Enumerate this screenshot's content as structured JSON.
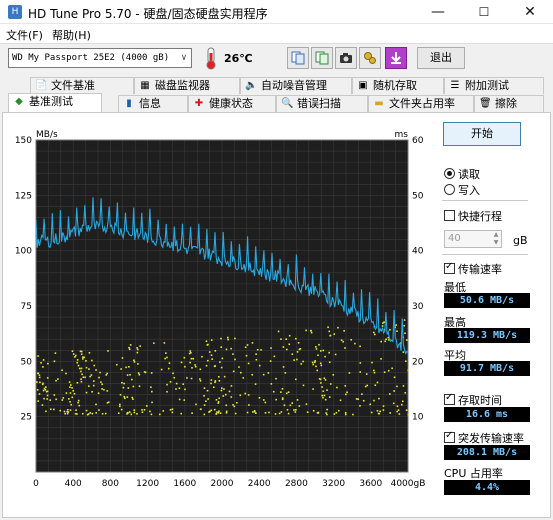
{
  "window": {
    "title": "HD Tune Pro 5.70 - 硬盘/固态硬盘实用程序",
    "app_icon_char": "H",
    "minimize": "—",
    "maximize": "☐",
    "close": "✕"
  },
  "menu": {
    "file": "文件(F)",
    "help": "帮助(H)"
  },
  "toolbar": {
    "drive_value": "WD     My Passport 25E2 (4000 gB)",
    "temperature": "26℃",
    "exit_label": "退出"
  },
  "tabs_top": [
    "文件基准",
    "磁盘监视器",
    "自动噪音管理",
    "随机存取",
    "附加测试"
  ],
  "tabs_bottom": [
    "基准测试",
    "信息",
    "健康状态",
    "错误扫描",
    "文件夹占用率",
    "擦除"
  ],
  "side": {
    "start_label": "开始",
    "read_label": "读取",
    "write_label": "写入",
    "short_stroke_label": "快捷行程",
    "short_stroke_value": "40",
    "short_stroke_unit": "gB",
    "transfer_rate_label": "传输速率",
    "min_label": "最低",
    "min_value": "50.6 MB/s",
    "max_label": "最高",
    "max_value": "119.3 MB/s",
    "avg_label": "平均",
    "avg_value": "91.7 MB/s",
    "access_time_label": "存取时间",
    "access_time_value": "16.6 ms",
    "burst_rate_label": "突发传输速率",
    "burst_rate_value": "208.1 MB/s",
    "cpu_label": "CPU 占用率",
    "cpu_value": "4.4%"
  },
  "colors": {
    "rate_line": "#2aa8e0",
    "access_dots": "#e8e83a",
    "lcd_text": "#7ec8ff",
    "chart_bg": "#1e1e1e"
  },
  "chart_data": {
    "type": "line",
    "left_unit": "MB/s",
    "right_unit": "ms",
    "y_ticks_left": [
      "150",
      "125",
      "100",
      "75",
      "50",
      "25"
    ],
    "y_ticks_right": [
      "60",
      "50",
      "40",
      "30",
      "20",
      "10"
    ],
    "x_ticks": [
      "0",
      "400",
      "800",
      "1200",
      "1600",
      "2000",
      "2400",
      "2800",
      "3200",
      "3600",
      "4000gB"
    ],
    "xlim": [
      0,
      4000
    ],
    "ylim_left": [
      0,
      150
    ],
    "ylim_right": [
      0,
      60
    ],
    "grid": true,
    "series": [
      {
        "kind": "transfer_rate",
        "x": [
          0,
          100,
          200,
          300,
          400,
          500,
          600,
          700,
          800,
          900,
          1000,
          1100,
          1200,
          1300,
          1400,
          1500,
          1600,
          1700,
          1800,
          1900,
          2000,
          2100,
          2200,
          2300,
          2400,
          2500,
          2600,
          2700,
          2800,
          2900,
          3000,
          3100,
          3200,
          3300,
          3400,
          3500,
          3600,
          3700,
          3800,
          3900,
          4000
        ],
        "values": [
          104,
          104,
          105,
          106,
          108,
          110,
          111,
          110,
          112,
          109,
          108,
          107,
          106,
          105,
          104,
          102,
          101,
          100,
          99,
          98,
          96,
          95,
          94,
          92,
          91,
          89,
          88,
          86,
          85,
          83,
          81,
          79,
          77,
          75,
          72,
          70,
          67,
          64,
          61,
          58,
          55
        ]
      },
      {
        "kind": "access_time",
        "x_range": [
          0,
          4000
        ],
        "y_range_ms": [
          10,
          28
        ]
      }
    ]
  }
}
